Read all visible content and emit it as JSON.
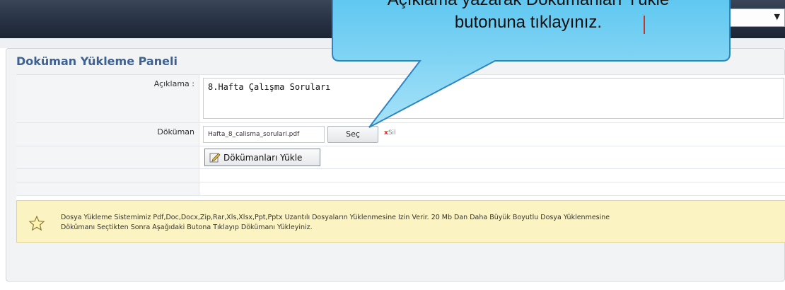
{
  "top_select": {
    "value": ""
  },
  "panel": {
    "title": "Doküman Yükleme Paneli"
  },
  "form": {
    "description_label": "Açıklama :",
    "description_value": "8.Hafta Çalışma Soruları",
    "document_label": "Döküman",
    "file_name": "Hafta_8_calisma_sorulari.pdf",
    "choose_button": "Seç",
    "remove_x": "x",
    "remove_label": "Sil",
    "upload_button": "Dökümanları Yükle"
  },
  "notice": {
    "line1": "Dosya Yükleme Sistemimiz Pdf,Doc,Docx,Zip,Rar,Xls,Xlsx,Ppt,Pptx Uzantılı Dosyaların Yüklenmesine Izin Verir. 20 Mb Dan Daha Büyük Boyutlu Dosya Yüklenmesine",
    "line2": "Dökümanı Seçtikten Sonra Aşağıdaki Butona Tıklayıp Dökümanı Yükleyiniz."
  },
  "callout": {
    "line1": "Açıklama yazarak Dökümanları Yükle",
    "line2": "butonuna tıklayınız."
  }
}
